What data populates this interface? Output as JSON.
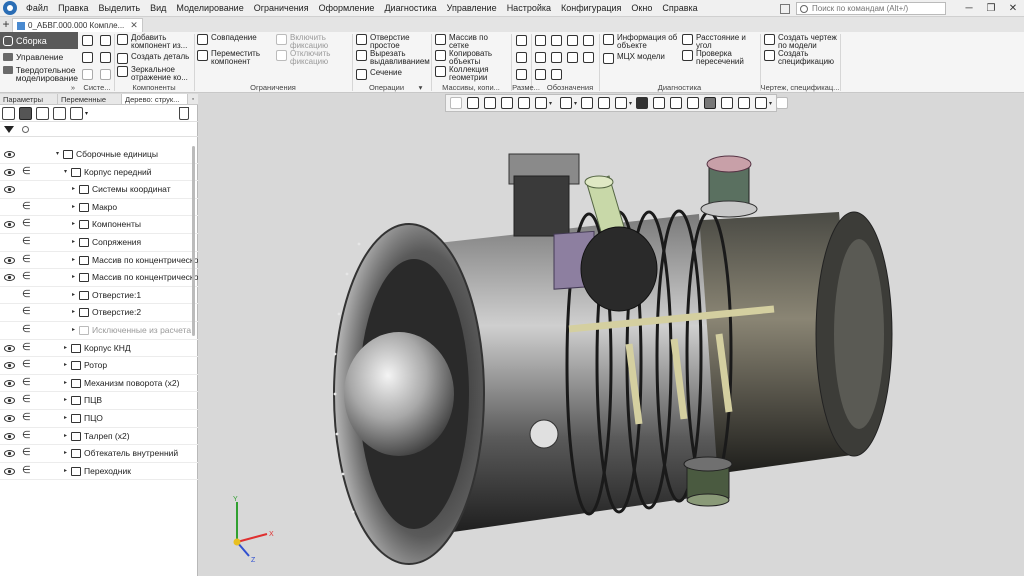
{
  "menubar": {
    "items": [
      "Файл",
      "Правка",
      "Выделить",
      "Вид",
      "Моделирование",
      "Ограничения",
      "Оформление",
      "Диагностика",
      "Управление",
      "Настройка",
      "Конфигурация",
      "Окно",
      "Справка"
    ],
    "search_placeholder": "Поиск по командам (Alt+/)"
  },
  "tabs": {
    "document": "0_АБВГ.000.000 Компле..."
  },
  "ribbon": {
    "mode_active": "Сборка",
    "modes": [
      "Управление",
      "Твердотельное\nмоделирование"
    ],
    "buttons": {
      "add_component": "Добавить\nкомпонент из...",
      "create_part": "Создать деталь",
      "mirror_component": "Зеркальное\nотражение ко...",
      "coincidence": "Совпадение",
      "move_component": "Переместить\nкомпонент",
      "enable_fixation": "Включить\nфиксацию",
      "disable_fixation": "Отключить\nфиксацию",
      "simple_hole": "Отверстие\nпростое",
      "cut_extrude": "Вырезать\nвыдавливанием",
      "section": "Сечение",
      "pattern_grid": "Массив по\nсетке",
      "copy_objects": "Копировать\nобъекты",
      "geometry_collection": "Коллекция\nгеометрии",
      "object_info": "Информация об\nобъекте",
      "mass_properties": "МЦХ модели",
      "distance_angle": "Расстояние и\nугол",
      "check_intersections": "Проверка\nпересечений",
      "create_drawing": "Создать чертеж\nпо модели",
      "create_spec": "Создать\nспецификацию"
    },
    "groups": {
      "system": "Систе...",
      "components": "Компоненты",
      "constraints": "Ограничения",
      "operations": "Операции",
      "patterns": "Массивы, копи...",
      "dimensions": "Разме...",
      "designations": "Обозначения",
      "diagnostics": "Диагностика",
      "drawing_spec": "Чертеж, спецификац..."
    }
  },
  "panel": {
    "tabs": [
      "Параметры",
      "Переменные",
      "Дерево: струк..."
    ],
    "tree": [
      {
        "label": "Сборочные единицы",
        "level": 0,
        "eye": true,
        "incl": false,
        "arrow": "▾",
        "dim": false
      },
      {
        "label": "Корпус передний",
        "level": 1,
        "eye": true,
        "incl": true,
        "arrow": "▾",
        "dim": false
      },
      {
        "label": "Системы координат",
        "level": 2,
        "eye": true,
        "incl": false,
        "arrow": "▸",
        "dim": false
      },
      {
        "label": "Макро",
        "level": 2,
        "eye": false,
        "incl": true,
        "arrow": "▸",
        "dim": false
      },
      {
        "label": "Компоненты",
        "level": 2,
        "eye": true,
        "incl": true,
        "arrow": "▸",
        "dim": false
      },
      {
        "label": "Сопряжения",
        "level": 2,
        "eye": false,
        "incl": true,
        "arrow": "▸",
        "dim": false
      },
      {
        "label": "Массив по концентрической",
        "level": 2,
        "eye": true,
        "incl": true,
        "arrow": "▸",
        "dim": false
      },
      {
        "label": "Массив по концентрической",
        "level": 2,
        "eye": true,
        "incl": true,
        "arrow": "▸",
        "dim": false
      },
      {
        "label": "Отверстие:1",
        "level": 2,
        "eye": false,
        "incl": true,
        "arrow": "▸",
        "dim": false
      },
      {
        "label": "Отверстие:2",
        "level": 2,
        "eye": false,
        "incl": true,
        "arrow": "▸",
        "dim": false
      },
      {
        "label": "Исключенные из расчета",
        "level": 2,
        "eye": false,
        "incl": true,
        "arrow": "▸",
        "dim": true
      },
      {
        "label": "Корпус КНД",
        "level": 1,
        "eye": true,
        "incl": true,
        "arrow": "▸",
        "dim": false
      },
      {
        "label": "Ротор",
        "level": 1,
        "eye": true,
        "incl": true,
        "arrow": "▸",
        "dim": false
      },
      {
        "label": "Механизм поворота (x2)",
        "level": 1,
        "eye": true,
        "incl": true,
        "arrow": "▸",
        "dim": false
      },
      {
        "label": "ПЦВ",
        "level": 1,
        "eye": true,
        "incl": true,
        "arrow": "▸",
        "dim": false
      },
      {
        "label": "ПЦО",
        "level": 1,
        "eye": true,
        "incl": true,
        "arrow": "▸",
        "dim": false
      },
      {
        "label": "Талреп (x2)",
        "level": 1,
        "eye": true,
        "incl": true,
        "arrow": "▸",
        "dim": false
      },
      {
        "label": "Обтекатель внутренний",
        "level": 1,
        "eye": true,
        "incl": true,
        "arrow": "▸",
        "dim": false
      },
      {
        "label": "Переходник",
        "level": 1,
        "eye": true,
        "incl": true,
        "arrow": "▸",
        "dim": false
      }
    ]
  },
  "viewport": {
    "axes": {
      "x": "X",
      "y": "Y",
      "z": "Z"
    }
  },
  "colors": {
    "accent": "#5a5a5a",
    "axis_x": "#e03030",
    "axis_y": "#30a030",
    "axis_z": "#3050d0"
  }
}
